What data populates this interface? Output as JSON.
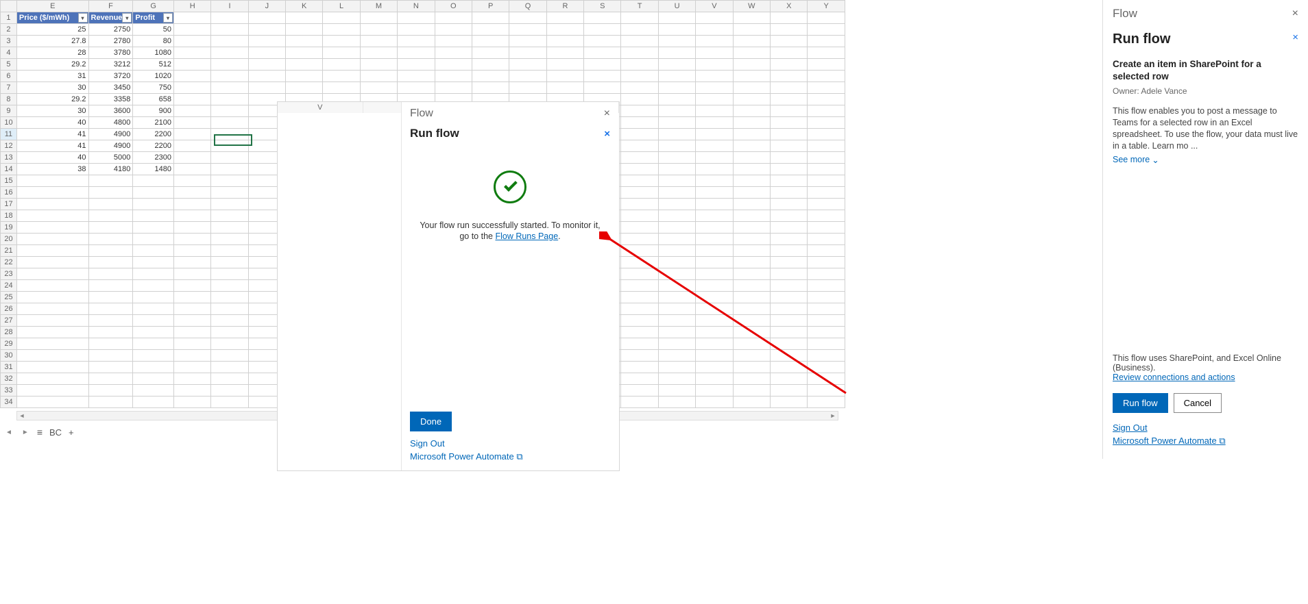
{
  "spreadsheet": {
    "visible_columns": [
      "E",
      "F",
      "G",
      "H",
      "I",
      "J",
      "K",
      "L",
      "M",
      "N",
      "O",
      "P",
      "Q",
      "R",
      "S",
      "T",
      "U",
      "V",
      "W",
      "X",
      "Y"
    ],
    "visible_rows": [
      1,
      2,
      3,
      4,
      5,
      6,
      7,
      8,
      9,
      10,
      11,
      12,
      13,
      14,
      15,
      16,
      17,
      18,
      19,
      20,
      21,
      22,
      23,
      24,
      25,
      26,
      27,
      28,
      29,
      30,
      31,
      32,
      33,
      34
    ],
    "selected_row": 11,
    "cursor_cell": "I11",
    "table_headers": [
      "Price ($/mWh)",
      "Revenue",
      "Profit"
    ],
    "rows": [
      {
        "price": 25,
        "revenue": 2750,
        "profit": 50
      },
      {
        "price": 27.8,
        "revenue": 2780,
        "profit": 80
      },
      {
        "price": 28,
        "revenue": 3780,
        "profit": 1080
      },
      {
        "price": 29.2,
        "revenue": 3212,
        "profit": 512
      },
      {
        "price": 31,
        "revenue": 3720,
        "profit": 1020
      },
      {
        "price": 30,
        "revenue": 3450,
        "profit": 750
      },
      {
        "price": 29.2,
        "revenue": 3358,
        "profit": 658
      },
      {
        "price": 30,
        "revenue": 3600,
        "profit": 900
      },
      {
        "price": 40,
        "revenue": 4800,
        "profit": 2100
      },
      {
        "price": 41,
        "revenue": 4900,
        "profit": 2200
      },
      {
        "price": 41,
        "revenue": 4900,
        "profit": 2200
      },
      {
        "price": 40,
        "revenue": 5000,
        "profit": 2300
      },
      {
        "price": 38,
        "revenue": 4180,
        "profit": 1480
      }
    ],
    "tab_name": "BC"
  },
  "popup": {
    "pane_title": "Flow",
    "heading": "Run flow",
    "success_msg_pre": "Your flow run successfully started. To monitor it, go to the ",
    "success_link": "Flow Runs Page",
    "done_btn": "Done",
    "signout": "Sign Out",
    "power_automate": "Microsoft Power Automate",
    "bg_cols": [
      "V",
      "W",
      "X"
    ]
  },
  "flow_pane": {
    "pane_title": "Flow",
    "heading": "Run flow",
    "flow_name": "Create an item in SharePoint for a selected row",
    "owner_label": "Owner: Adele Vance",
    "description": "This flow enables you to post a message to Teams for a selected row in an Excel spreadsheet. To use the flow, your data must live in a table. Learn mo ...",
    "see_more": "See more",
    "uses_text": "This flow uses SharePoint, and Excel Online (Business).",
    "review_link": "Review connections and actions",
    "run_btn": "Run flow",
    "cancel_btn": "Cancel",
    "signout": "Sign Out",
    "power_automate": "Microsoft Power Automate"
  }
}
